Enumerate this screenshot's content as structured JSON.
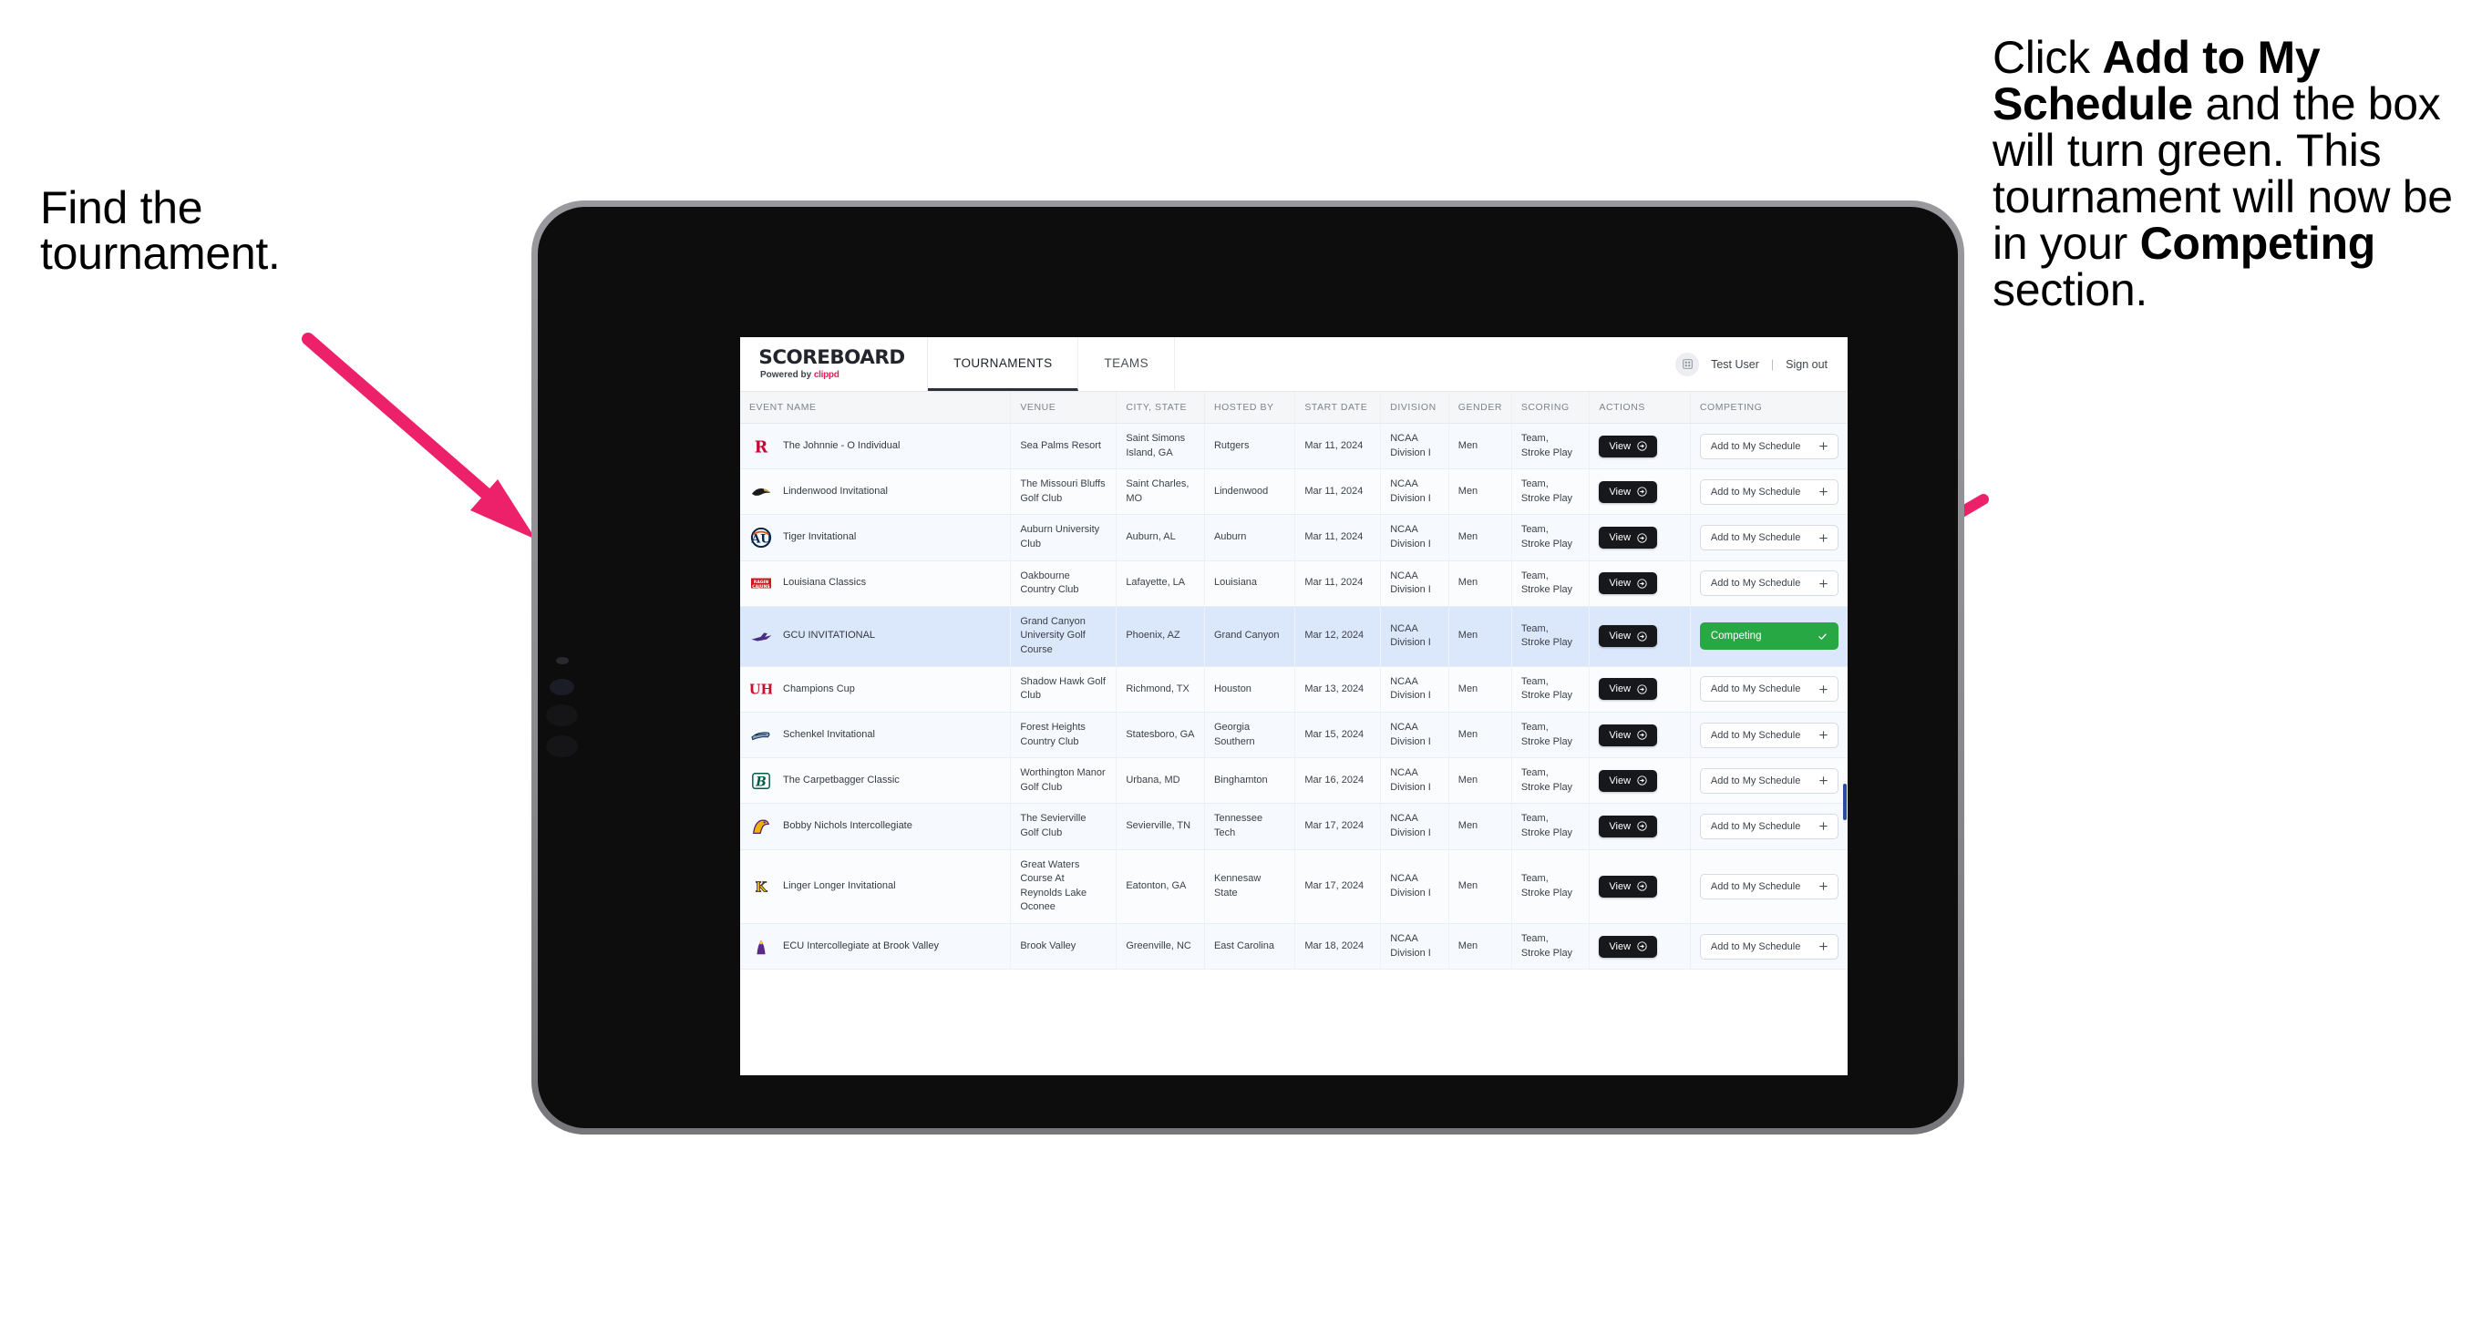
{
  "annotations": {
    "left": [
      "Find the",
      "tournament."
    ],
    "right_html": "Click <b>Add to My Schedule</b> and the box will turn green. This tournament will now be in your <b>Competing</b> section.",
    "arrow_color": "#ed2169"
  },
  "app": {
    "brand": {
      "title": "SCOREBOARD",
      "powered_prefix": "Powered by ",
      "powered_brand": "clippd"
    },
    "tabs": [
      {
        "label": "TOURNAMENTS",
        "active": true
      },
      {
        "label": "TEAMS",
        "active": false
      }
    ],
    "user": {
      "name": "Test User",
      "separator": "|",
      "sign_out": "Sign out",
      "avatar_icon": "grid-icon"
    },
    "table": {
      "columns": [
        "EVENT NAME",
        "VENUE",
        "CITY, STATE",
        "HOSTED BY",
        "START DATE",
        "DIVISION",
        "GENDER",
        "SCORING",
        "ACTIONS",
        "COMPETING"
      ],
      "view_label": "View",
      "add_label": "Add to My Schedule",
      "add_icon": "plus-icon",
      "view_icon": "arrow-right-circle-icon",
      "competing_label": "Competing",
      "competing_icon": "check-icon",
      "competing_color": "#28a745",
      "rows": [
        {
          "logo": "rutgers-logo",
          "event": "The Johnnie - O Individual",
          "venue": "Sea Palms Resort",
          "city": "Saint Simons Island, GA",
          "host": "Rutgers",
          "date": "Mar 11, 2024",
          "division": "NCAA Division I",
          "gender": "Men",
          "scoring": "Team, Stroke Play",
          "competing": false
        },
        {
          "logo": "lindenwood-logo",
          "event": "Lindenwood Invitational",
          "venue": "The Missouri Bluffs Golf Club",
          "city": "Saint Charles, MO",
          "host": "Lindenwood",
          "date": "Mar 11, 2024",
          "division": "NCAA Division I",
          "gender": "Men",
          "scoring": "Team, Stroke Play",
          "competing": false
        },
        {
          "logo": "auburn-logo",
          "event": "Tiger Invitational",
          "venue": "Auburn University Club",
          "city": "Auburn, AL",
          "host": "Auburn",
          "date": "Mar 11, 2024",
          "division": "NCAA Division I",
          "gender": "Men",
          "scoring": "Team, Stroke Play",
          "competing": false
        },
        {
          "logo": "louisiana-logo",
          "event": "Louisiana Classics",
          "venue": "Oakbourne Country Club",
          "city": "Lafayette, LA",
          "host": "Louisiana",
          "date": "Mar 11, 2024",
          "division": "NCAA Division I",
          "gender": "Men",
          "scoring": "Team, Stroke Play",
          "competing": false
        },
        {
          "logo": "gcu-logo",
          "event": "GCU INVITATIONAL",
          "venue": "Grand Canyon University Golf Course",
          "city": "Phoenix, AZ",
          "host": "Grand Canyon",
          "date": "Mar 12, 2024",
          "division": "NCAA Division I",
          "gender": "Men",
          "scoring": "Team, Stroke Play",
          "competing": true,
          "selected": true
        },
        {
          "logo": "houston-logo",
          "event": "Champions Cup",
          "venue": "Shadow Hawk Golf Club",
          "city": "Richmond, TX",
          "host": "Houston",
          "date": "Mar 13, 2024",
          "division": "NCAA Division I",
          "gender": "Men",
          "scoring": "Team, Stroke Play",
          "competing": false
        },
        {
          "logo": "georgia-southern-logo",
          "event": "Schenkel Invitational",
          "venue": "Forest Heights Country Club",
          "city": "Statesboro, GA",
          "host": "Georgia Southern",
          "date": "Mar 15, 2024",
          "division": "NCAA Division I",
          "gender": "Men",
          "scoring": "Team, Stroke Play",
          "competing": false
        },
        {
          "logo": "binghamton-logo",
          "event": "The Carpetbagger Classic",
          "venue": "Worthington Manor Golf Club",
          "city": "Urbana, MD",
          "host": "Binghamton",
          "date": "Mar 16, 2024",
          "division": "NCAA Division I",
          "gender": "Men",
          "scoring": "Team, Stroke Play",
          "competing": false
        },
        {
          "logo": "tennessee-tech-logo",
          "event": "Bobby Nichols Intercollegiate",
          "venue": "The Sevierville Golf Club",
          "city": "Sevierville, TN",
          "host": "Tennessee Tech",
          "date": "Mar 17, 2024",
          "division": "NCAA Division I",
          "gender": "Men",
          "scoring": "Team, Stroke Play",
          "competing": false
        },
        {
          "logo": "kennesaw-state-logo",
          "event": "Linger Longer Invitational",
          "venue": "Great Waters Course At Reynolds Lake Oconee",
          "city": "Eatonton, GA",
          "host": "Kennesaw State",
          "date": "Mar 17, 2024",
          "division": "NCAA Division I",
          "gender": "Men",
          "scoring": "Team, Stroke Play",
          "competing": false
        },
        {
          "logo": "ecu-logo",
          "event": "ECU Intercollegiate at Brook Valley",
          "venue": "Brook Valley",
          "city": "Greenville, NC",
          "host": "East Carolina",
          "date": "Mar 18, 2024",
          "division": "NCAA Division I",
          "gender": "Men",
          "scoring": "Team, Stroke Play",
          "competing": false
        }
      ]
    }
  }
}
